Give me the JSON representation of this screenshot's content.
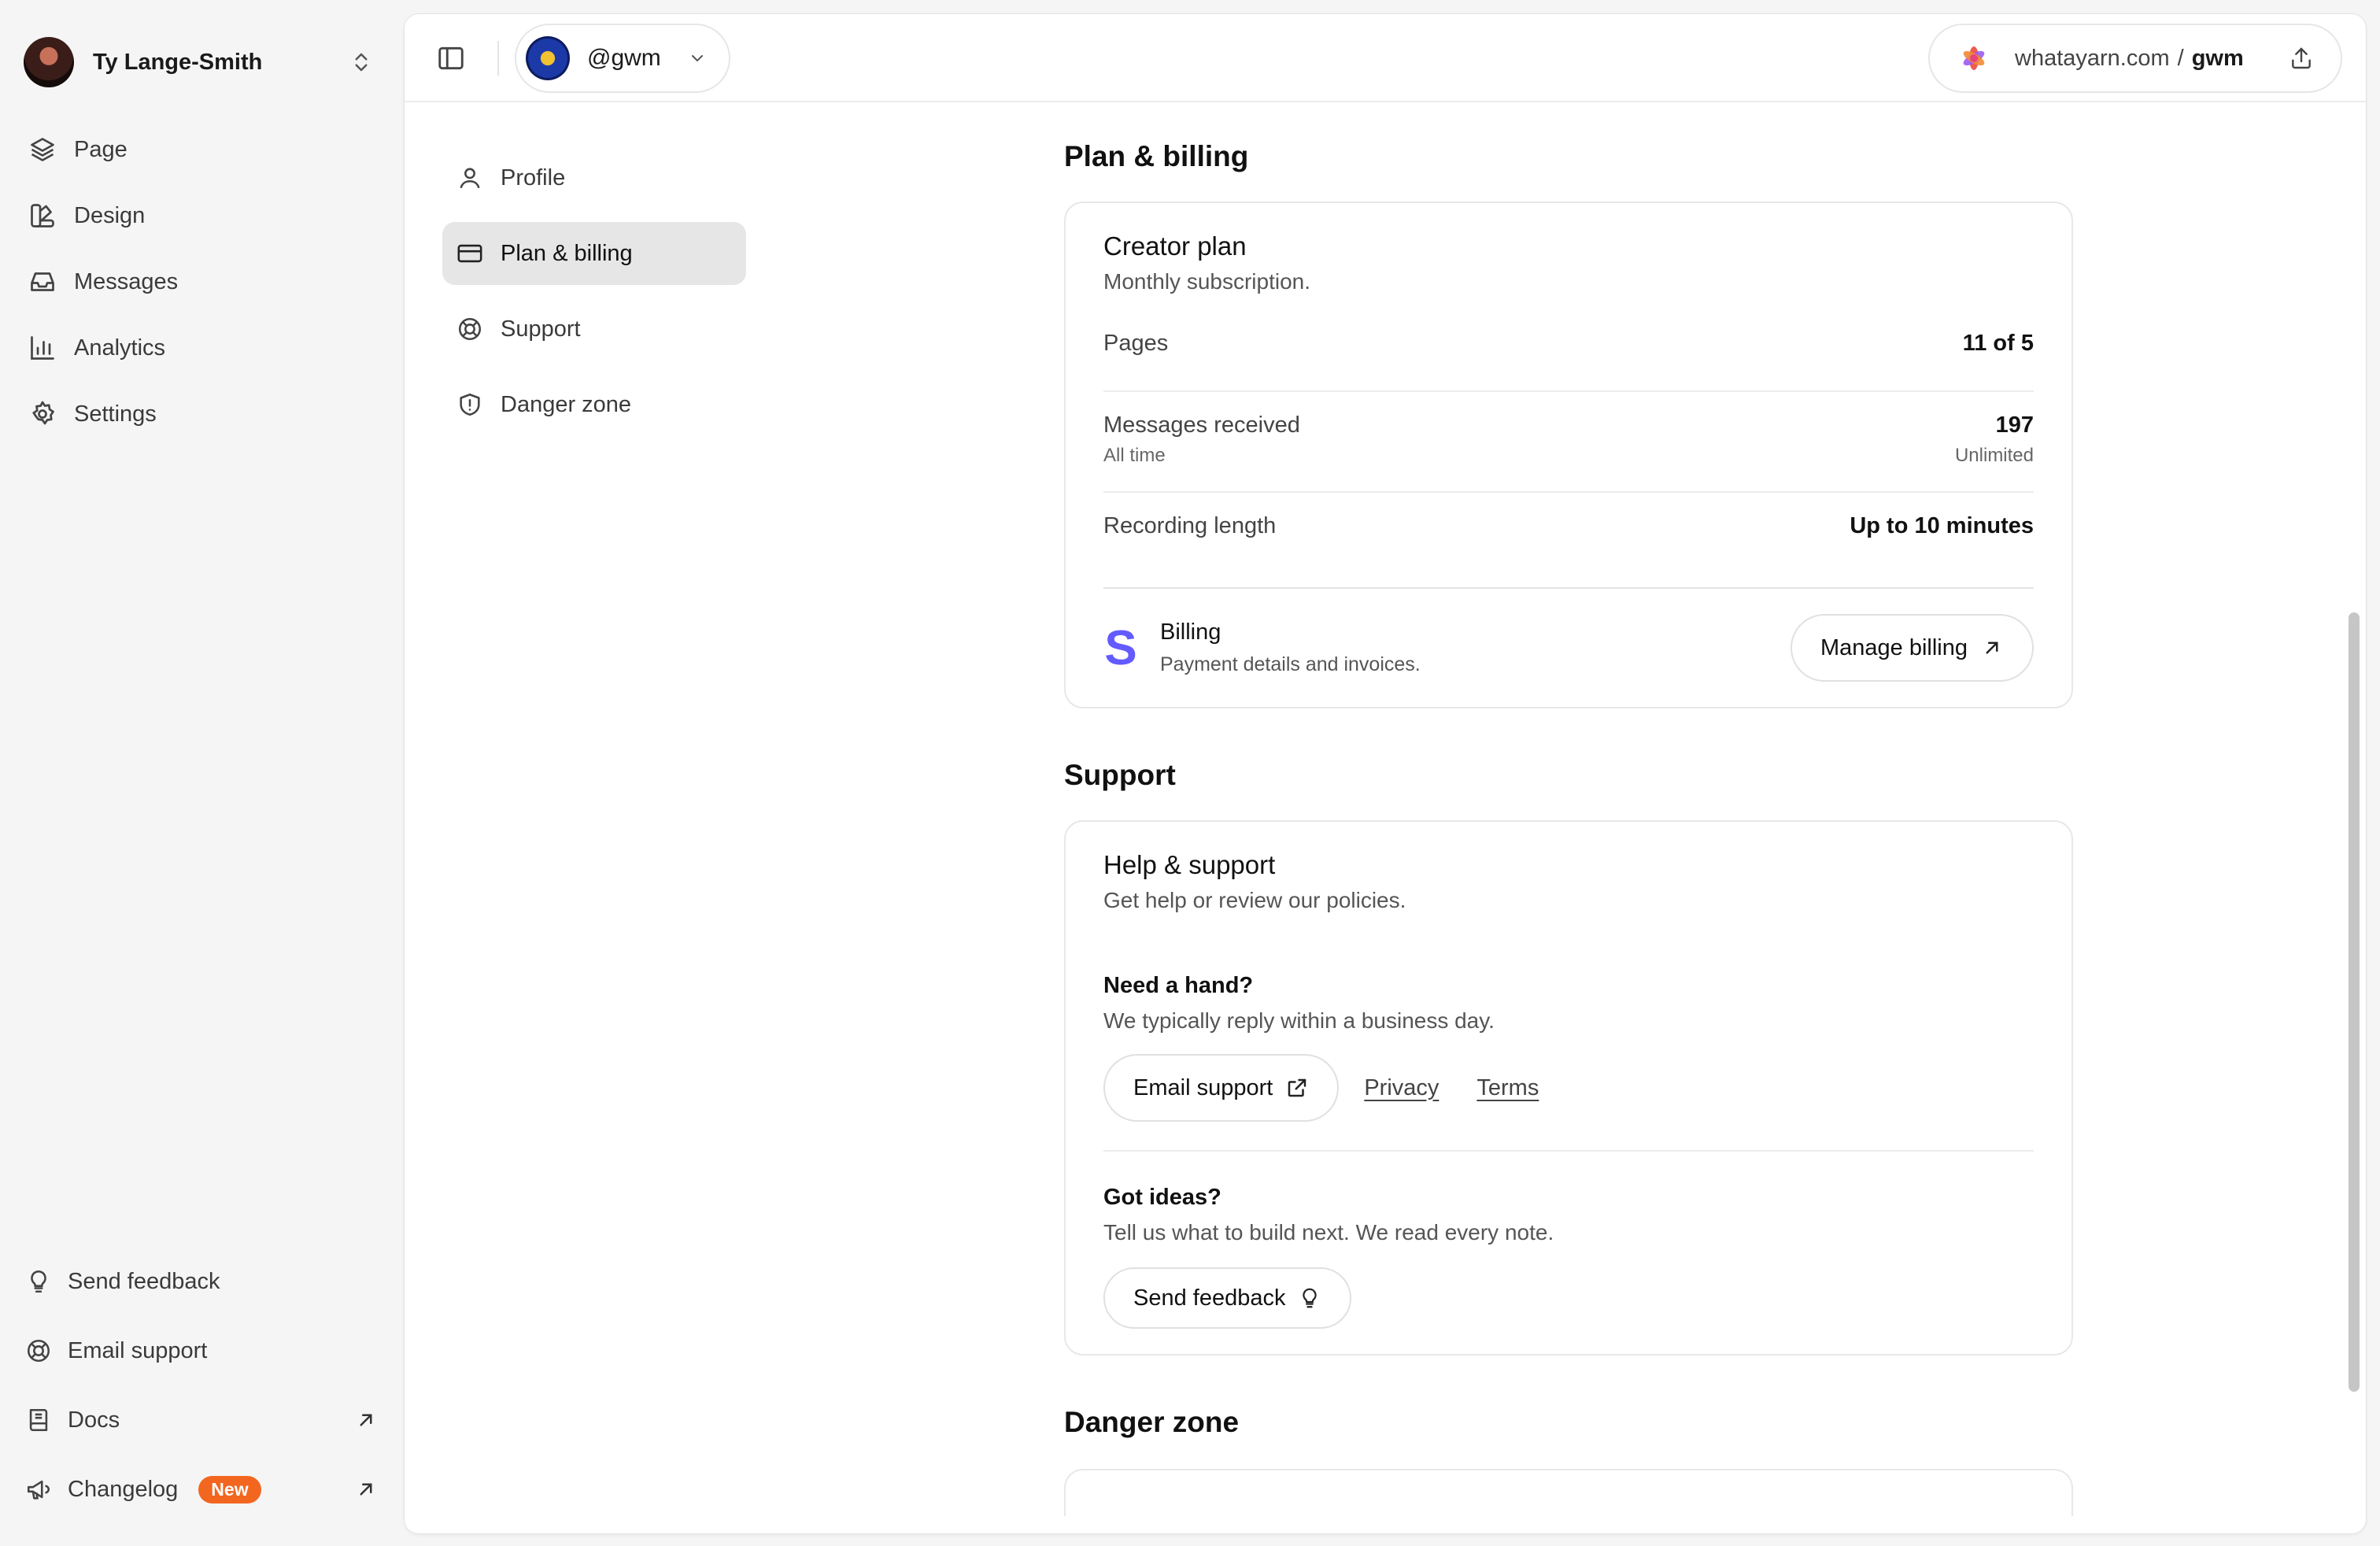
{
  "sidebar": {
    "user_name": "Ty Lange-Smith",
    "nav": [
      {
        "label": "Page",
        "icon": "layers-icon"
      },
      {
        "label": "Design",
        "icon": "palette-icon"
      },
      {
        "label": "Messages",
        "icon": "inbox-icon"
      },
      {
        "label": "Analytics",
        "icon": "bar-chart-icon"
      },
      {
        "label": "Settings",
        "icon": "gear-icon"
      }
    ],
    "bottom": [
      {
        "label": "Send feedback",
        "icon": "lightbulb-icon"
      },
      {
        "label": "Email support",
        "icon": "lifebuoy-icon"
      },
      {
        "label": "Docs",
        "icon": "book-icon"
      },
      {
        "label": "Changelog",
        "icon": "megaphone-icon",
        "badge": "New"
      }
    ]
  },
  "topbar": {
    "page_handle": "@gwm",
    "url_domain": "whatayarn.com",
    "url_separator": "/",
    "url_handle": "gwm"
  },
  "settings_nav": [
    {
      "label": "Profile",
      "icon": "user-icon",
      "active": false
    },
    {
      "label": "Plan & billing",
      "icon": "credit-card-icon",
      "active": true
    },
    {
      "label": "Support",
      "icon": "lifebuoy-icon",
      "active": false
    },
    {
      "label": "Danger zone",
      "icon": "shield-alert-icon",
      "active": false
    }
  ],
  "plan": {
    "section_title": "Plan & billing",
    "card_title": "Creator plan",
    "card_subtitle": "Monthly subscription.",
    "rows": [
      {
        "label": "Pages",
        "value": "11 of 5"
      },
      {
        "label": "Messages received",
        "sublabel": "All time",
        "value": "197",
        "subvalue": "Unlimited"
      },
      {
        "label": "Recording length",
        "value": "Up to 10 minutes"
      }
    ],
    "billing_title": "Billing",
    "billing_subtitle": "Payment details and invoices.",
    "manage_button": "Manage billing"
  },
  "support": {
    "section_title": "Support",
    "card_title": "Help & support",
    "card_subtitle": "Get help or review our policies.",
    "hand_title": "Need a hand?",
    "hand_sub": "We typically reply within a business day.",
    "email_button": "Email support",
    "privacy_link": "Privacy",
    "terms_link": "Terms",
    "ideas_title": "Got ideas?",
    "ideas_sub": "Tell us what to build next. We read every note.",
    "feedback_button": "Send feedback"
  },
  "danger": {
    "section_title": "Danger zone"
  },
  "colors": {
    "accent_orange": "#f2661f",
    "stripe_purple": "#635bff",
    "active_nav_bg": "#e6e6e6"
  }
}
